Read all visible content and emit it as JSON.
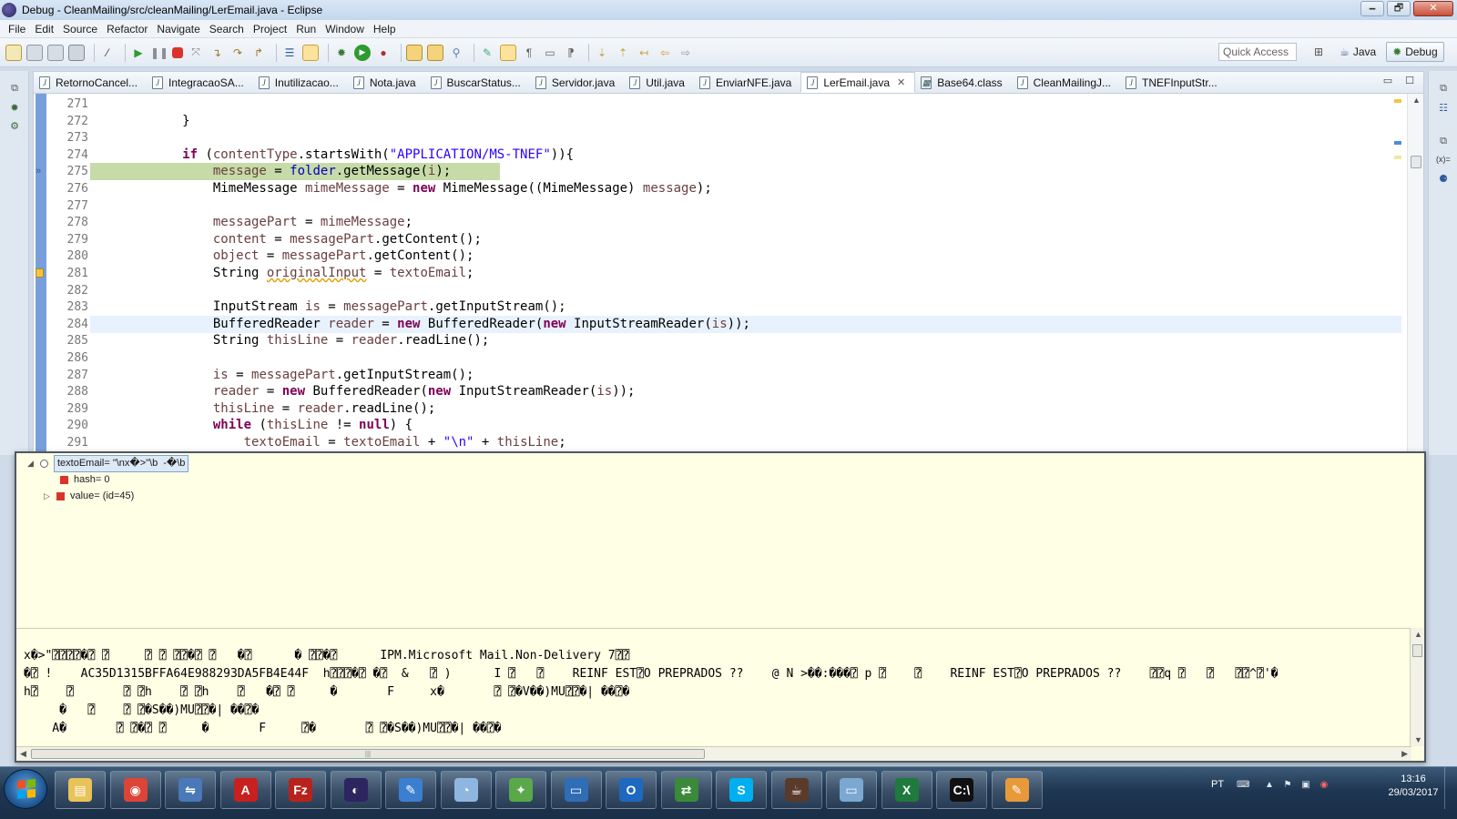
{
  "window": {
    "title": "Debug - CleanMailing/src/cleanMailing/LerEmail.java - Eclipse",
    "minimize": "🗕",
    "restore": "🗗",
    "close": "✕"
  },
  "menu": [
    "File",
    "Edit",
    "Source",
    "Refactor",
    "Navigate",
    "Search",
    "Project",
    "Run",
    "Window",
    "Help"
  ],
  "toolbar": {
    "quick_access": "Quick Access",
    "perspectives": [
      "Java",
      "Debug"
    ]
  },
  "tabs": [
    {
      "label": "RetornoCancel..."
    },
    {
      "label": "IntegracaoSA..."
    },
    {
      "label": "Inutilizacao..."
    },
    {
      "label": "Nota.java"
    },
    {
      "label": "BuscarStatus..."
    },
    {
      "label": "Servidor.java"
    },
    {
      "label": "Util.java"
    },
    {
      "label": "EnviarNFE.java"
    },
    {
      "label": "LerEmail.java",
      "active": true
    },
    {
      "label": "Base64.class"
    },
    {
      "label": "CleanMailingJ..."
    },
    {
      "label": "TNEFInputStr..."
    }
  ],
  "editor": {
    "lines": [
      {
        "n": "271",
        "tokens": []
      },
      {
        "n": "272",
        "tokens": [
          {
            "t": "            }"
          }
        ]
      },
      {
        "n": "273",
        "tokens": []
      },
      {
        "n": "274",
        "tokens": [
          {
            "t": "            "
          },
          {
            "t": "if",
            "c": "kw"
          },
          {
            "t": " ("
          },
          {
            "t": "contentType",
            "c": "lv"
          },
          {
            "t": ".startsWith("
          },
          {
            "t": "\"APPLICATION/MS-TNEF\"",
            "c": "str"
          },
          {
            "t": ")){"
          }
        ]
      },
      {
        "n": "275",
        "debug": true,
        "tokens": [
          {
            "t": "                "
          },
          {
            "t": "message",
            "c": "lv"
          },
          {
            "t": " = "
          },
          {
            "t": "folder",
            "c": "fld"
          },
          {
            "t": ".getMessage("
          },
          {
            "t": "i",
            "c": "lv"
          },
          {
            "t": ");"
          }
        ]
      },
      {
        "n": "276",
        "tokens": [
          {
            "t": "                MimeMessage "
          },
          {
            "t": "mimeMessage",
            "c": "lv"
          },
          {
            "t": " = "
          },
          {
            "t": "new",
            "c": "kw"
          },
          {
            "t": " MimeMessage((MimeMessage) "
          },
          {
            "t": "message",
            "c": "lv"
          },
          {
            "t": ");"
          }
        ]
      },
      {
        "n": "277",
        "tokens": []
      },
      {
        "n": "278",
        "tokens": [
          {
            "t": "                "
          },
          {
            "t": "messagePart",
            "c": "lv"
          },
          {
            "t": " = "
          },
          {
            "t": "mimeMessage",
            "c": "lv"
          },
          {
            "t": ";"
          }
        ]
      },
      {
        "n": "279",
        "tokens": [
          {
            "t": "                "
          },
          {
            "t": "content",
            "c": "lv"
          },
          {
            "t": " = "
          },
          {
            "t": "messagePart",
            "c": "lv"
          },
          {
            "t": ".getContent();"
          }
        ]
      },
      {
        "n": "280",
        "tokens": [
          {
            "t": "                "
          },
          {
            "t": "object",
            "c": "lv"
          },
          {
            "t": " = "
          },
          {
            "t": "messagePart",
            "c": "lv"
          },
          {
            "t": ".getContent();"
          }
        ]
      },
      {
        "n": "281",
        "warning": true,
        "tokens": [
          {
            "t": "                String "
          },
          {
            "t": "originalInput",
            "c": "lv warn-underline"
          },
          {
            "t": " = "
          },
          {
            "t": "textoEmail",
            "c": "lv"
          },
          {
            "t": ";"
          }
        ]
      },
      {
        "n": "282",
        "tokens": []
      },
      {
        "n": "283",
        "tokens": [
          {
            "t": "                InputStream "
          },
          {
            "t": "is",
            "c": "lv"
          },
          {
            "t": " = "
          },
          {
            "t": "messagePart",
            "c": "lv"
          },
          {
            "t": ".getInputStream();"
          }
        ]
      },
      {
        "n": "284",
        "current": true,
        "tokens": [
          {
            "t": "                BufferedReader "
          },
          {
            "t": "reader",
            "c": "lv"
          },
          {
            "t": " = "
          },
          {
            "t": "new",
            "c": "kw"
          },
          {
            "t": " BufferedReader("
          },
          {
            "t": "new",
            "c": "kw"
          },
          {
            "t": " InputStreamReader("
          },
          {
            "t": "is",
            "c": "lv"
          },
          {
            "t": "));"
          }
        ]
      },
      {
        "n": "285",
        "tokens": [
          {
            "t": "                String "
          },
          {
            "t": "thisLine",
            "c": "lv"
          },
          {
            "t": " = "
          },
          {
            "t": "reader",
            "c": "lv"
          },
          {
            "t": ".readLine();"
          }
        ]
      },
      {
        "n": "286",
        "tokens": []
      },
      {
        "n": "287",
        "tokens": [
          {
            "t": "                "
          },
          {
            "t": "is",
            "c": "lv"
          },
          {
            "t": " = "
          },
          {
            "t": "messagePart",
            "c": "lv"
          },
          {
            "t": ".getInputStream();"
          }
        ]
      },
      {
        "n": "288",
        "tokens": [
          {
            "t": "                "
          },
          {
            "t": "reader",
            "c": "lv"
          },
          {
            "t": " = "
          },
          {
            "t": "new",
            "c": "kw"
          },
          {
            "t": " BufferedReader("
          },
          {
            "t": "new",
            "c": "kw"
          },
          {
            "t": " InputStreamReader("
          },
          {
            "t": "is",
            "c": "lv"
          },
          {
            "t": "));"
          }
        ]
      },
      {
        "n": "289",
        "tokens": [
          {
            "t": "                "
          },
          {
            "t": "thisLine",
            "c": "lv"
          },
          {
            "t": " = "
          },
          {
            "t": "reader",
            "c": "lv"
          },
          {
            "t": ".readLine();"
          }
        ]
      },
      {
        "n": "290",
        "tokens": [
          {
            "t": "                "
          },
          {
            "t": "while",
            "c": "kw"
          },
          {
            "t": " ("
          },
          {
            "t": "thisLine",
            "c": "lv"
          },
          {
            "t": " != "
          },
          {
            "t": "null",
            "c": "kw"
          },
          {
            "t": ") {"
          }
        ]
      },
      {
        "n": "291",
        "tokens": [
          {
            "t": "                    "
          },
          {
            "t": "textoEmail",
            "c": "lv"
          },
          {
            "t": " = "
          },
          {
            "t": "textoEmail",
            "c": "lv"
          },
          {
            "t": " + "
          },
          {
            "t": "\"\\n\"",
            "c": "str"
          },
          {
            "t": " + "
          },
          {
            "t": "thisLine",
            "c": "lv"
          },
          {
            "t": ";"
          }
        ]
      }
    ]
  },
  "inspector": {
    "root": "textoEmail= \"\\nx�>\"\\b⁣  -�\\b",
    "children": [
      "hash= 0",
      "value= (id=45)"
    ],
    "value_lines": [
      "x�>\"⍰⍰⍰⍰�⍰ ⍰     ⍰ ⍰ ⍰⍰�⍰ ⍰   �⍰      � ⍰⍰�⍰      IPM.Microsoft Mail.Non-Delivery 7⍰⍰",
      "�⍰ !    AC35D1315BFFA64E988293DA5FB4E44F  h⍰⍰⍰�⍰ �⍰  &   ⍰ )      I ⍰   ⍰    REINF EST⍰O PREPRADOS ??    @ N >��:���⍰ p ⍰    ⍰    REINF EST⍰O PREPRADOS ??    ⍰⍰q ⍰   ⍰   ⍰⍰^⍰'�",
      "h⍰    ⍰       ⍰ ⍰h    ⍰ ⍰h    ⍰   �⍰ ⍰     �       F     x�       ⍰ ⍰�V��)MU⍰⍰�| ��⍰�",
      "     �   ⍰    ⍰ ⍰�S��)MU⍰⍰�| ��⍰�",
      "    A�       ⍰ ⍰�⍰ ⍰     �       F     ⍰�       ⍰ ⍰�S��)MU⍰⍰�| ��⍰�"
    ]
  },
  "taskbar": {
    "apps": [
      "file-explorer",
      "chrome",
      "network-connect",
      "acrobat-reader",
      "filezilla",
      "eclipse",
      "sticky-folder",
      "image-viewer",
      "game-app",
      "virtualbox",
      "outlook",
      "remote-desktop",
      "skype",
      "java-ee-ide",
      "notepad",
      "excel",
      "command-prompt",
      "paint"
    ],
    "lang": "PT",
    "time": "13:16",
    "date": "29/03/2017"
  },
  "colors": {
    "keyword": "#7f0055",
    "string": "#2a00ff",
    "field": "#0000c0",
    "local_var": "#6a3e3e",
    "debug_line": "#c6dba8",
    "current_line": "#e8f2fe"
  }
}
